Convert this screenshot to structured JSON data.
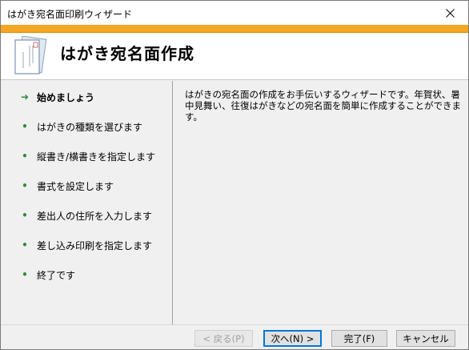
{
  "window": {
    "title": "はがき宛名面印刷ウィザード"
  },
  "header": {
    "title": "はがき宛名面作成",
    "icon": "postcard-icon",
    "accent_color": "#f5a623"
  },
  "steps": [
    {
      "label": "始めましょう",
      "active": true,
      "marker": "➜"
    },
    {
      "label": "はがきの種類を選びます",
      "active": false,
      "marker": "•"
    },
    {
      "label": "縦書き/横書きを指定します",
      "active": false,
      "marker": "•"
    },
    {
      "label": "書式を設定します",
      "active": false,
      "marker": "•"
    },
    {
      "label": "差出人の住所を入力します",
      "active": false,
      "marker": "•"
    },
    {
      "label": "差し込み印刷を指定します",
      "active": false,
      "marker": "•"
    },
    {
      "label": "終了です",
      "active": false,
      "marker": "•"
    }
  ],
  "content": {
    "description": "はがきの宛名面の作成をお手伝いするウィザードです。年賀状、暑中見舞い、往復はがきなどの宛名面を簡単に作成することができます。"
  },
  "buttons": {
    "back": "< 戻る(P)",
    "next": "次へ(N) >",
    "finish": "完了(F)",
    "cancel": "キャンセル"
  }
}
